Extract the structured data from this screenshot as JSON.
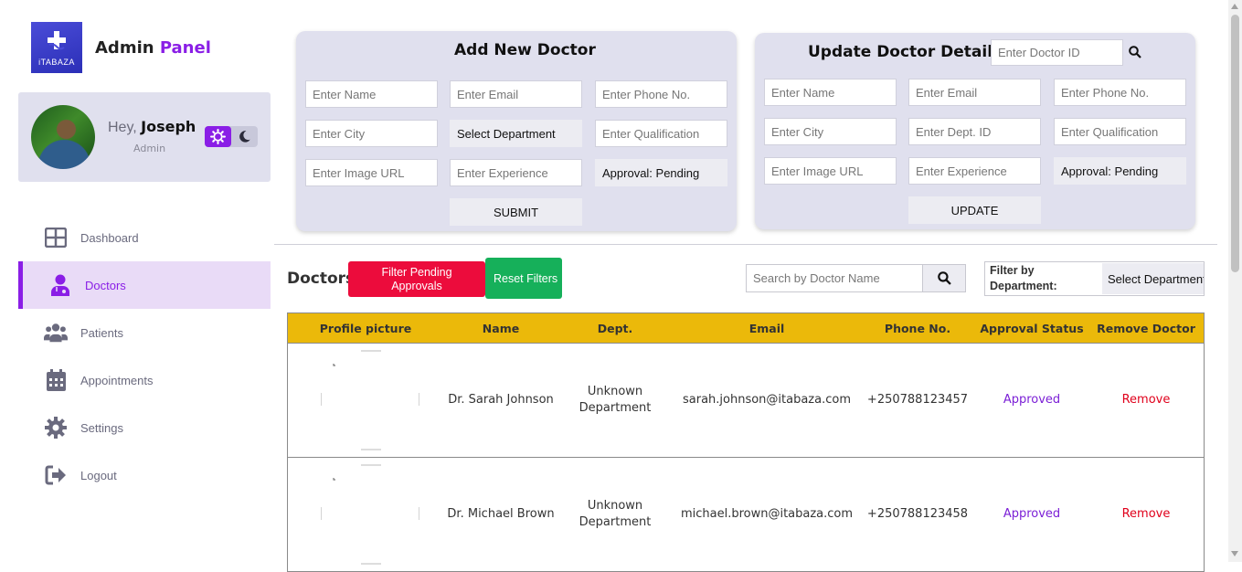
{
  "brand": {
    "title_main": "Admin ",
    "title_accent": "Panel",
    "logo_text": "iTABAZA"
  },
  "profile": {
    "greeting": "Hey, ",
    "name": "Joseph",
    "role": "Admin"
  },
  "nav": [
    {
      "label": "Dashboard",
      "icon": "dashboard-icon"
    },
    {
      "label": "Doctors",
      "icon": "doctor-icon",
      "active": true
    },
    {
      "label": "Patients",
      "icon": "patients-icon"
    },
    {
      "label": "Appointments",
      "icon": "calendar-icon"
    },
    {
      "label": "Settings",
      "icon": "gear-icon"
    },
    {
      "label": "Logout",
      "icon": "logout-icon"
    }
  ],
  "add_form": {
    "title": "Add New Doctor",
    "name_placeholder": "Enter Name",
    "email_placeholder": "Enter Email",
    "phone_placeholder": "Enter Phone No.",
    "city_placeholder": "Enter City",
    "department_select": "Select Department",
    "qualification_placeholder": "Enter Qualification",
    "image_placeholder": "Enter Image URL",
    "experience_placeholder": "Enter Experience",
    "approval_value": "Approval: Pending",
    "submit_label": "SUBMIT"
  },
  "update_form": {
    "title": "Update Doctor Details:",
    "doctor_id_placeholder": "Enter Doctor ID",
    "name_placeholder": "Enter Name",
    "email_placeholder": "Enter Email",
    "phone_placeholder": "Enter Phone No.",
    "city_placeholder": "Enter City",
    "dept_id_placeholder": "Enter Dept. ID",
    "qualification_placeholder": "Enter Qualification",
    "image_placeholder": "Enter Image URL",
    "experience_placeholder": "Enter Experience",
    "approval_value": "Approval: Pending",
    "update_label": "UPDATE"
  },
  "doctors_section": {
    "title": "Doctors",
    "filter_pending_label": "Filter Pending Approvals",
    "reset_filters_label": "Reset Filters",
    "search_placeholder": "Search by Doctor Name",
    "filter_department_label": "Filter by Department:",
    "filter_department_value": "Select Department"
  },
  "table": {
    "headers": [
      "Profile picture",
      "Name",
      "Dept.",
      "Email",
      "Phone No.",
      "Approval Status",
      "Remove Doctor"
    ],
    "rows": [
      {
        "name": "Dr. Sarah Johnson",
        "dept": "Unknown Department",
        "email": "sarah.johnson@itabaza.com",
        "phone": "+250788123457",
        "status": "Approved",
        "action": "Remove"
      },
      {
        "name": "Dr. Michael Brown",
        "dept": "Unknown Department",
        "email": "michael.brown@itabaza.com",
        "phone": "+250788123458",
        "status": "Approved",
        "action": "Remove"
      }
    ]
  },
  "colors": {
    "accent": "#8a1ee6",
    "header": "#ebb90a",
    "danger": "#ec0c3c",
    "success": "#16b05a",
    "panel": "#e0e0ee"
  }
}
